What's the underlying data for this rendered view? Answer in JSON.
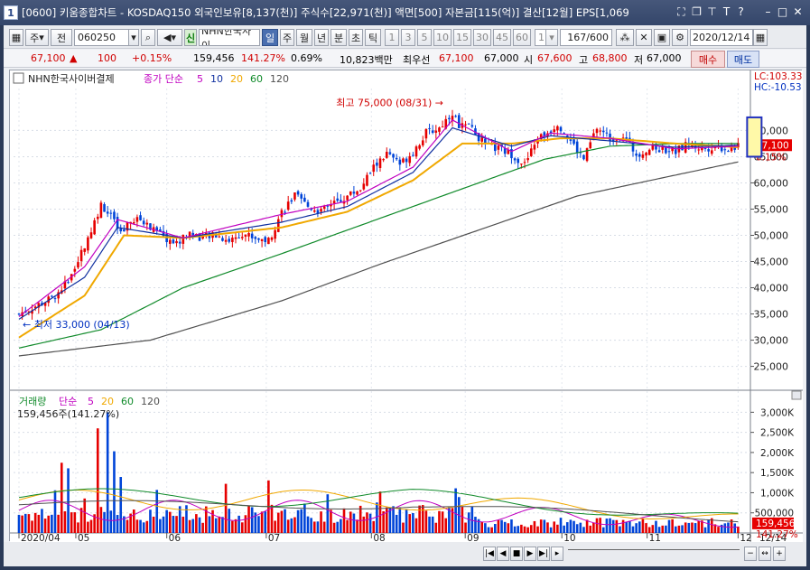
{
  "window": {
    "index": "1",
    "title": "[0600] 키움종합차트 - KOSDAQ150 외국인보유[8,137(천)] 주식수[22,971(천)] 액면[500] 자본금[115(억)] 결산[12월] EPS[1,069"
  },
  "toolbar": {
    "period_type": "주",
    "prev_label": "전",
    "code": "060250",
    "new_badge": "신",
    "stock_name": "NHN한국사이",
    "period_tabs": [
      "일",
      "주",
      "월",
      "년",
      "분",
      "초",
      "틱"
    ],
    "minute_options": [
      "1",
      "3",
      "5",
      "10",
      "15",
      "30",
      "45",
      "60"
    ],
    "interval_value": "1",
    "count": "167/600",
    "date": "2020/12/14"
  },
  "quote": {
    "price": "67,100",
    "arrow": "▲",
    "change": "100",
    "change_pct": "+0.15%",
    "volume": "159,456",
    "volume_ratio": "141.27%",
    "turnover": "0.69%",
    "amount": "10,823백만",
    "best_ask_label": "최우선",
    "best_ask": "67,100",
    "best_bid": "67,000",
    "open_label": "시",
    "open": "67,600",
    "high_label": "고",
    "high": "68,800",
    "low_label": "저",
    "low": "67,000",
    "buy_label": "매수",
    "sell_label": "매도"
  },
  "price_panel": {
    "stock": "NHN한국사이버결제",
    "legend_prefix": "종가 단순",
    "ma_labels": [
      "5",
      "10",
      "20",
      "60",
      "120"
    ],
    "lc": "LC:103.33",
    "hc": "HC:-10.53",
    "max_label": "최고 75,000 (08/31)",
    "min_label": "최저 33,000 (04/13)",
    "last_price": "67,100",
    "last_pct": "0.15%"
  },
  "volume_panel": {
    "legend_prefix": "거래량",
    "legend_simple": "단순",
    "ma_labels": [
      "5",
      "20",
      "60",
      "120"
    ],
    "info": "159,456주(141.27%)",
    "last_value": "159,456",
    "last_pct": "141.27%"
  },
  "x_axis": {
    "labels": [
      "2020/04",
      "05",
      "06",
      "07",
      "08",
      "09",
      "10",
      "11",
      "12"
    ],
    "current": "12/14"
  },
  "colors": {
    "up": "#e60000",
    "down": "#0044d8",
    "ma5": "#c000c0",
    "ma10": "#1030a0",
    "ma20": "#f0a800",
    "ma60": "#108a2a",
    "ma120": "#505050"
  },
  "chart_data": {
    "type": "candlestick",
    "y_price_ticks": [
      25000,
      30000,
      35000,
      40000,
      45000,
      50000,
      55000,
      60000,
      65000,
      70000
    ],
    "y_price_range": [
      22000,
      78000
    ],
    "y_volume_ticks": [
      500000,
      1000000,
      1500000,
      2000000,
      2500000,
      3000000
    ],
    "y_volume_range": [
      0,
      3300000
    ],
    "y_volume_labels": [
      "500,000",
      "1,000K",
      "1,500K",
      "2,000K",
      "2,500K",
      "3,000K"
    ],
    "close_path": [
      [
        0,
        35000
      ],
      [
        5,
        36500
      ],
      [
        10,
        38000
      ],
      [
        14,
        40500
      ],
      [
        18,
        45500
      ],
      [
        22,
        51000
      ],
      [
        25,
        56000
      ],
      [
        28,
        53500
      ],
      [
        31,
        50000
      ],
      [
        34,
        52500
      ],
      [
        37,
        53000
      ],
      [
        40,
        51500
      ],
      [
        44,
        49500
      ],
      [
        48,
        48500
      ],
      [
        52,
        50500
      ],
      [
        56,
        49500
      ],
      [
        60,
        50000
      ],
      [
        64,
        49000
      ],
      [
        68,
        50500
      ],
      [
        72,
        49500
      ],
      [
        76,
        49000
      ],
      [
        80,
        54500
      ],
      [
        84,
        57500
      ],
      [
        88,
        55500
      ],
      [
        92,
        54500
      ],
      [
        96,
        56000
      ],
      [
        100,
        57500
      ],
      [
        104,
        59000
      ],
      [
        108,
        63000
      ],
      [
        112,
        65500
      ],
      [
        116,
        63500
      ],
      [
        120,
        66000
      ],
      [
        124,
        69500
      ],
      [
        128,
        70500
      ],
      [
        132,
        73500
      ],
      [
        134,
        71000
      ],
      [
        138,
        70500
      ],
      [
        142,
        67000
      ],
      [
        146,
        66500
      ],
      [
        150,
        65500
      ],
      [
        154,
        63500
      ],
      [
        158,
        68500
      ],
      [
        162,
        70000
      ],
      [
        164,
        71500
      ],
      [
        168,
        68000
      ],
      [
        172,
        64500
      ],
      [
        176,
        70500
      ],
      [
        180,
        68500
      ],
      [
        184,
        69000
      ],
      [
        188,
        65500
      ],
      [
        192,
        66500
      ],
      [
        196,
        66500
      ],
      [
        200,
        66000
      ],
      [
        204,
        67500
      ],
      [
        208,
        66500
      ],
      [
        212,
        67000
      ],
      [
        216,
        66500
      ],
      [
        219,
        67100
      ]
    ],
    "ma_approx": {
      "ma5": [
        [
          0,
          34500
        ],
        [
          20,
          44000
        ],
        [
          30,
          53000
        ],
        [
          50,
          49500
        ],
        [
          80,
          54000
        ],
        [
          100,
          56500
        ],
        [
          120,
          63000
        ],
        [
          132,
          72000
        ],
        [
          150,
          66000
        ],
        [
          162,
          69500
        ],
        [
          180,
          68500
        ],
        [
          200,
          66500
        ],
        [
          219,
          67000
        ]
      ],
      "ma10": [
        [
          0,
          34000
        ],
        [
          20,
          42000
        ],
        [
          30,
          51500
        ],
        [
          50,
          49500
        ],
        [
          80,
          52500
        ],
        [
          100,
          55500
        ],
        [
          120,
          62000
        ],
        [
          132,
          70500
        ],
        [
          150,
          67000
        ],
        [
          162,
          69000
        ],
        [
          180,
          68000
        ],
        [
          200,
          66800
        ],
        [
          219,
          67200
        ]
      ],
      "ma20": [
        [
          0,
          30500
        ],
        [
          20,
          38500
        ],
        [
          32,
          50000
        ],
        [
          50,
          49500
        ],
        [
          80,
          51500
        ],
        [
          100,
          54500
        ],
        [
          120,
          60500
        ],
        [
          135,
          67500
        ],
        [
          150,
          67500
        ],
        [
          165,
          68500
        ],
        [
          180,
          68500
        ],
        [
          200,
          67500
        ],
        [
          219,
          66800
        ]
      ],
      "ma60": [
        [
          0,
          28500
        ],
        [
          25,
          32000
        ],
        [
          50,
          40000
        ],
        [
          80,
          46500
        ],
        [
          100,
          51000
        ],
        [
          120,
          55500
        ],
        [
          140,
          60000
        ],
        [
          160,
          64500
        ],
        [
          180,
          67000
        ],
        [
          200,
          67500
        ],
        [
          219,
          67500
        ]
      ],
      "ma120": [
        [
          0,
          27000
        ],
        [
          40,
          30000
        ],
        [
          80,
          37500
        ],
        [
          110,
          44500
        ],
        [
          140,
          51000
        ],
        [
          170,
          57500
        ],
        [
          200,
          61500
        ],
        [
          219,
          64000
        ]
      ]
    },
    "volume_ma_level": 720000
  }
}
